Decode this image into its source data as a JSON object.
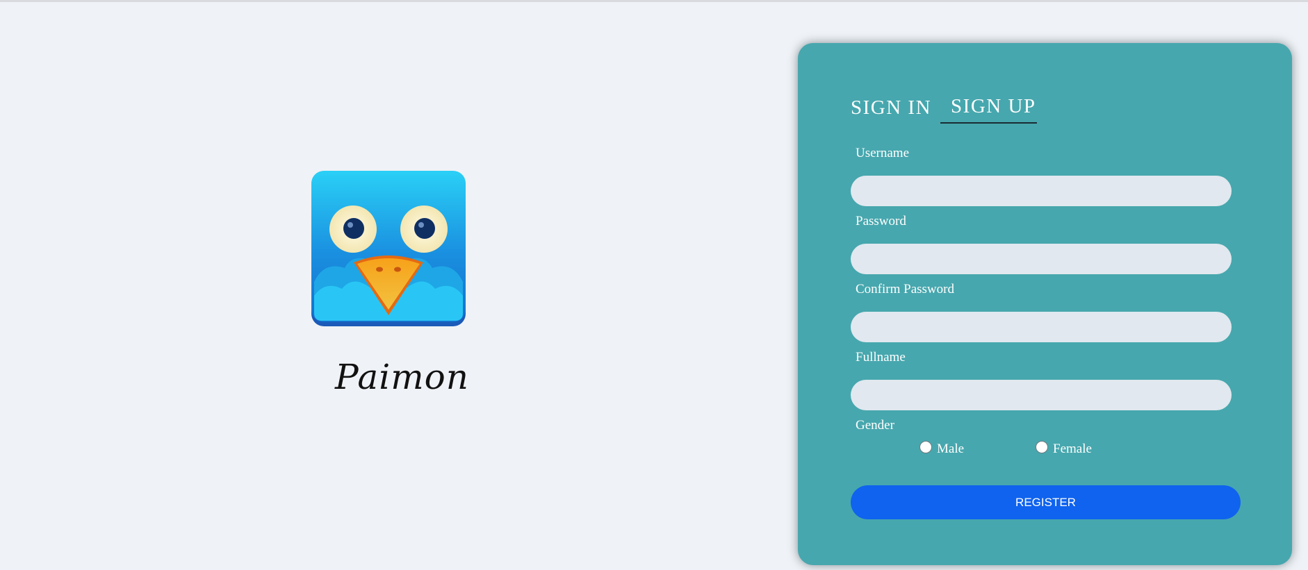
{
  "brand": {
    "app_name": "Paimon",
    "logo_icon": "owl-logo-icon"
  },
  "auth": {
    "tabs": [
      {
        "label": "SIGN IN",
        "active": false
      },
      {
        "label": "SIGN UP",
        "active": true
      }
    ],
    "fields": {
      "username": {
        "label": "Username",
        "value": "",
        "placeholder": ""
      },
      "password": {
        "label": "Password",
        "value": "",
        "placeholder": ""
      },
      "confirm_password": {
        "label": "Confirm Password",
        "value": "",
        "placeholder": ""
      },
      "fullname": {
        "label": "Fullname",
        "value": "",
        "placeholder": ""
      }
    },
    "gender": {
      "label": "Gender",
      "options": [
        {
          "label": "Male",
          "selected": false
        },
        {
          "label": "Female",
          "selected": false
        }
      ]
    },
    "submit_label": "REGISTER"
  },
  "colors": {
    "page_background": "#eff2f6",
    "panel_background": "#47a7ae",
    "input_background": "#e1e8ef",
    "primary_button": "#0f63ee"
  }
}
